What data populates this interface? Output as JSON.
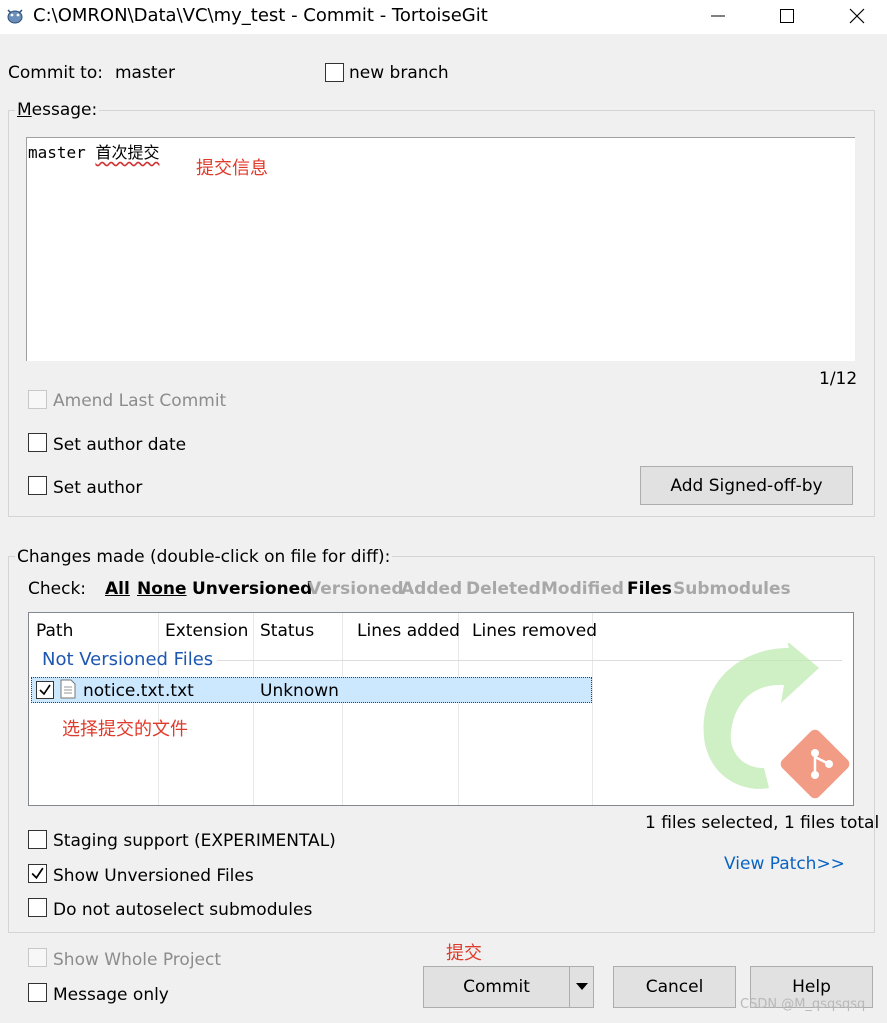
{
  "window": {
    "title": "C:\\OMRON\\Data\\VC\\my_test - Commit - TortoiseGit",
    "minimize_glyph": "—",
    "maximize_glyph": "☐",
    "close_glyph": "✕"
  },
  "commit_to": {
    "label": "Commit to:",
    "branch": "master",
    "new_branch_label": "new branch"
  },
  "message": {
    "group_label": "Message:",
    "text_ascii": "master ",
    "text_cjk": "首次提交",
    "annotation": "提交信息",
    "counter": "1/12",
    "amend_label": "Amend Last Commit",
    "set_author_date_label": "Set author date",
    "set_author_label": "Set author",
    "signed_off_button": "Add Signed-off-by"
  },
  "changes": {
    "group_label": "Changes made (double-click on file for diff):",
    "check_label": "Check:",
    "filters": [
      {
        "label": "All",
        "active": true
      },
      {
        "label": "None",
        "active": true
      },
      {
        "label": "Unversioned",
        "active": true
      },
      {
        "label": "Versioned",
        "active": false
      },
      {
        "label": "Added",
        "active": false
      },
      {
        "label": "Deleted",
        "active": false
      },
      {
        "label": "Modified",
        "active": false
      },
      {
        "label": "Files",
        "active": true
      },
      {
        "label": "Submodules",
        "active": false
      }
    ],
    "columns": [
      "Path",
      "Extension",
      "Status",
      "Lines added",
      "Lines removed"
    ],
    "group_header": "Not Versioned Files",
    "rows": [
      {
        "checked": true,
        "path": "notice.txt",
        "extension": ".txt",
        "status": "Unknown",
        "lines_added": "",
        "lines_removed": ""
      }
    ],
    "annotation": "选择提交的文件",
    "summary": "1 files selected, 1 files total",
    "staging_label": "Staging support (EXPERIMENTAL)",
    "show_unversioned_label": "Show Unversioned Files",
    "show_unversioned_checked": true,
    "no_autoselect_label": "Do not autoselect submodules",
    "view_patch": "View Patch>>"
  },
  "footer": {
    "show_whole_project_label": "Show Whole Project",
    "message_only_label": "Message only",
    "commit_annotation": "提交",
    "commit_button": "Commit",
    "cancel_button": "Cancel",
    "help_button": "Help",
    "watermark": "CSDN @M_qsqsqsq"
  },
  "colors": {
    "annotation_red": "#e03a2a",
    "link_blue": "#0a63c2",
    "selection_blue": "#cce8ff",
    "git_logo_red": "#f0532c",
    "arrow_green": "#8fd67f"
  }
}
